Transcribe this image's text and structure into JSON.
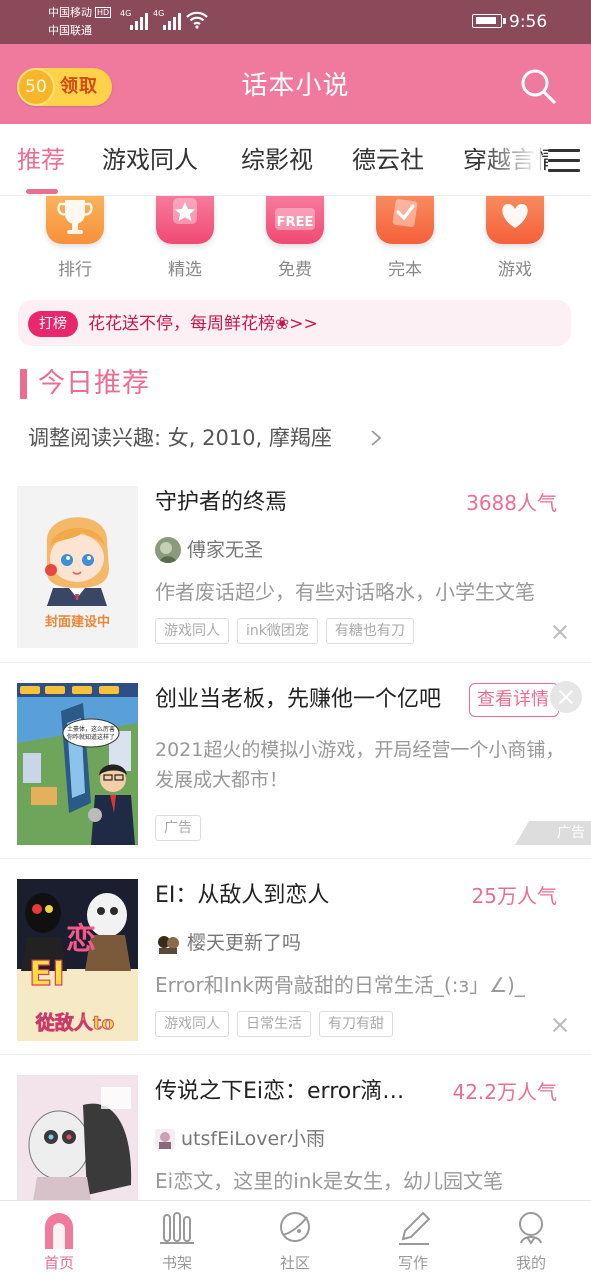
{
  "status_bar": {
    "carrier_1": "中国移动",
    "carrier_1_badge": "HD",
    "carrier_2": "中国联通",
    "network_1": "4G",
    "network_2": "4G",
    "time": "9:56"
  },
  "header": {
    "coin_count": "50",
    "claim_label": "领取",
    "title": "话本小说"
  },
  "tabs": [
    {
      "label": "推荐",
      "active": true
    },
    {
      "label": "游戏同人"
    },
    {
      "label": "综影视"
    },
    {
      "label": "德云社"
    },
    {
      "label": "穿越言情"
    }
  ],
  "categories": [
    {
      "label": "排行",
      "icon": "trophy-icon",
      "color": "#f79a3e"
    },
    {
      "label": "精选",
      "icon": "star-icon",
      "color": "#f2557e"
    },
    {
      "label": "免费",
      "icon": "free-icon",
      "color": "#f2557e",
      "badge": "FREE"
    },
    {
      "label": "完本",
      "icon": "check-document-icon",
      "color": "#f7683a"
    },
    {
      "label": "游戏",
      "icon": "heart-icon",
      "color": "#f7683a"
    }
  ],
  "banner": {
    "tag": "打榜",
    "text": "花花送不停，每周鲜花榜❀>>"
  },
  "section": {
    "title": "今日推荐",
    "preference": "调整阅读兴趣: 女, 2010, 摩羯座"
  },
  "books": [
    {
      "title": "守护者的终焉",
      "popularity": "3688人气",
      "author": "傅家无圣",
      "desc": "作者废话超少，有些对话略水，小学生文笔",
      "tags": [
        "游戏同人",
        "ink微团宠",
        "有糖也有刀"
      ],
      "cover_text": "封面建设中"
    },
    {
      "title": "创业当老板，先赚他一个亿吧",
      "cta": "查看详情",
      "desc": "2021超火的模拟小游戏，开局经营一个小商铺，发展成大都市！",
      "tags": [
        "广告"
      ],
      "corner": "广告",
      "cover_bubble": "土豪体，这么厉害你咋就知道这样了"
    },
    {
      "title": "EI：从敌人到恋人",
      "popularity": "25万人气",
      "author": "樱天更新了吗",
      "desc": "Error和Ink两骨敲甜的日常生活_(:з」∠)_",
      "tags": [
        "游戏同人",
        "日常生活",
        "有刀有甜"
      ],
      "cover_text_1": "EI",
      "cover_text_2": "恋",
      "cover_text_3": "從敌人to"
    },
    {
      "title": "传说之下Ei恋：error滴小娇妻",
      "popularity": "42.2万人气",
      "author": "utsfEiLover小雨",
      "desc": "Ei恋文，这里的ink是女生，幼儿园文笔"
    }
  ],
  "bottom_nav": [
    {
      "label": "首页",
      "icon": "home-icon",
      "active": true
    },
    {
      "label": "书架",
      "icon": "bookshelf-icon"
    },
    {
      "label": "社区",
      "icon": "planet-icon"
    },
    {
      "label": "写作",
      "icon": "pen-icon"
    },
    {
      "label": "我的",
      "icon": "profile-icon"
    }
  ],
  "colors": {
    "accent": "#ea6e92",
    "header": "#f07a9d",
    "status_bar": "#8a4a5a",
    "coin": "#ffd24a"
  }
}
